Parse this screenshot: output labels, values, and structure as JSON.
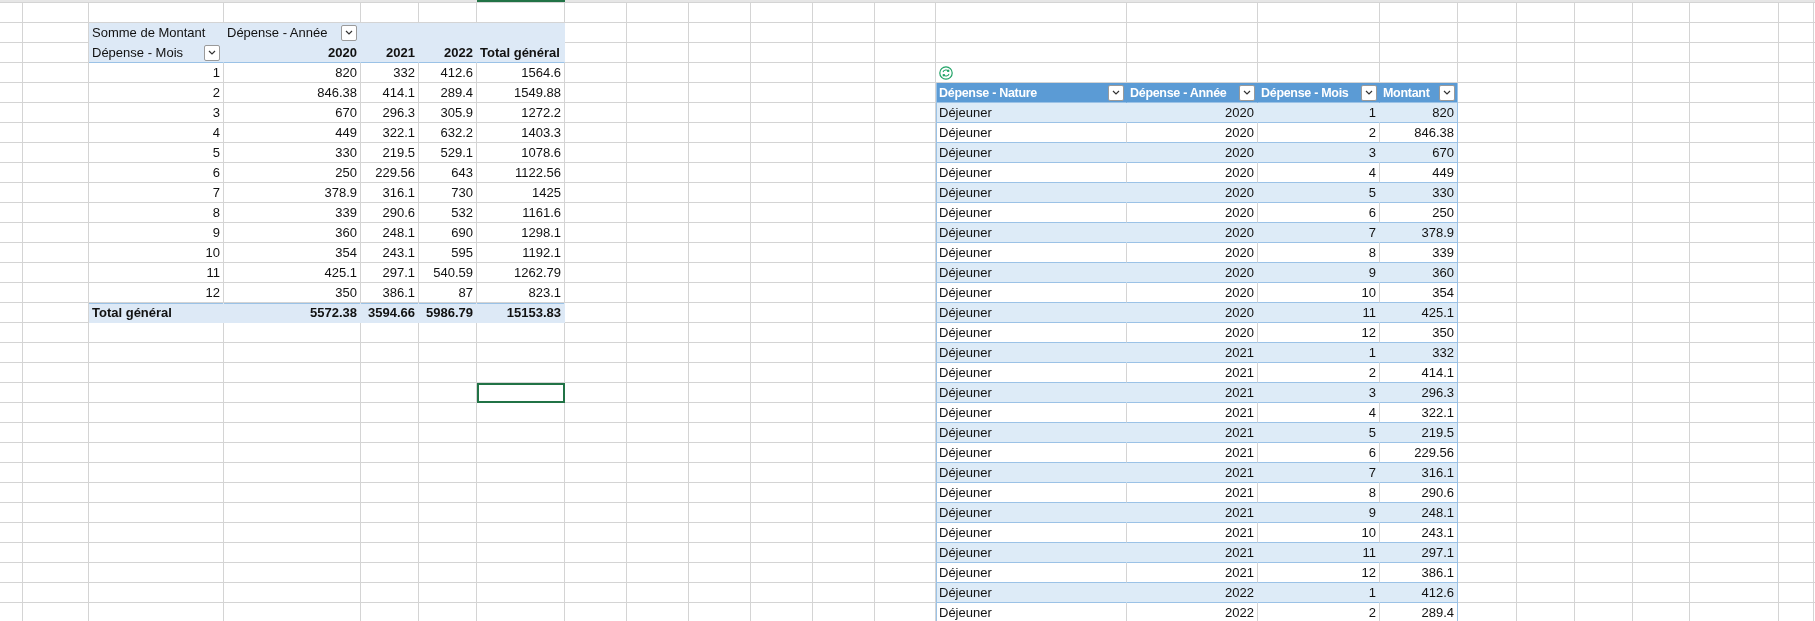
{
  "pivot_table": {
    "value_label": "Somme de Montant",
    "column_field": "Dépense - Année",
    "row_field": "Dépense - Mois",
    "columns": [
      "2020",
      "2021",
      "2022",
      "Total général"
    ],
    "rows": [
      {
        "label": "1",
        "values": [
          "820",
          "332",
          "412.6",
          "1564.6"
        ]
      },
      {
        "label": "2",
        "values": [
          "846.38",
          "414.1",
          "289.4",
          "1549.88"
        ]
      },
      {
        "label": "3",
        "values": [
          "670",
          "296.3",
          "305.9",
          "1272.2"
        ]
      },
      {
        "label": "4",
        "values": [
          "449",
          "322.1",
          "632.2",
          "1403.3"
        ]
      },
      {
        "label": "5",
        "values": [
          "330",
          "219.5",
          "529.1",
          "1078.6"
        ]
      },
      {
        "label": "6",
        "values": [
          "250",
          "229.56",
          "643",
          "1122.56"
        ]
      },
      {
        "label": "7",
        "values": [
          "378.9",
          "316.1",
          "730",
          "1425"
        ]
      },
      {
        "label": "8",
        "values": [
          "339",
          "290.6",
          "532",
          "1161.6"
        ]
      },
      {
        "label": "9",
        "values": [
          "360",
          "248.1",
          "690",
          "1298.1"
        ]
      },
      {
        "label": "10",
        "values": [
          "354",
          "243.1",
          "595",
          "1192.1"
        ]
      },
      {
        "label": "11",
        "values": [
          "425.1",
          "297.1",
          "540.59",
          "1262.79"
        ]
      },
      {
        "label": "12",
        "values": [
          "350",
          "386.1",
          "87",
          "823.1"
        ]
      }
    ],
    "total_row": {
      "label": "Total général",
      "values": [
        "5572.38",
        "3594.66",
        "5986.79",
        "15153.83"
      ]
    }
  },
  "data_table": {
    "columns": [
      "Dépense - Nature",
      "Dépense - Année",
      "Dépense - Mois",
      "Montant"
    ],
    "rows": [
      [
        "Déjeuner",
        "2020",
        "1",
        "820"
      ],
      [
        "Déjeuner",
        "2020",
        "2",
        "846.38"
      ],
      [
        "Déjeuner",
        "2020",
        "3",
        "670"
      ],
      [
        "Déjeuner",
        "2020",
        "4",
        "449"
      ],
      [
        "Déjeuner",
        "2020",
        "5",
        "330"
      ],
      [
        "Déjeuner",
        "2020",
        "6",
        "250"
      ],
      [
        "Déjeuner",
        "2020",
        "7",
        "378.9"
      ],
      [
        "Déjeuner",
        "2020",
        "8",
        "339"
      ],
      [
        "Déjeuner",
        "2020",
        "9",
        "360"
      ],
      [
        "Déjeuner",
        "2020",
        "10",
        "354"
      ],
      [
        "Déjeuner",
        "2020",
        "11",
        "425.1"
      ],
      [
        "Déjeuner",
        "2020",
        "12",
        "350"
      ],
      [
        "Déjeuner",
        "2021",
        "1",
        "332"
      ],
      [
        "Déjeuner",
        "2021",
        "2",
        "414.1"
      ],
      [
        "Déjeuner",
        "2021",
        "3",
        "296.3"
      ],
      [
        "Déjeuner",
        "2021",
        "4",
        "322.1"
      ],
      [
        "Déjeuner",
        "2021",
        "5",
        "219.5"
      ],
      [
        "Déjeuner",
        "2021",
        "6",
        "229.56"
      ],
      [
        "Déjeuner",
        "2021",
        "7",
        "316.1"
      ],
      [
        "Déjeuner",
        "2021",
        "8",
        "290.6"
      ],
      [
        "Déjeuner",
        "2021",
        "9",
        "248.1"
      ],
      [
        "Déjeuner",
        "2021",
        "10",
        "243.1"
      ],
      [
        "Déjeuner",
        "2021",
        "11",
        "297.1"
      ],
      [
        "Déjeuner",
        "2021",
        "12",
        "386.1"
      ],
      [
        "Déjeuner",
        "2022",
        "1",
        "412.6"
      ],
      [
        "Déjeuner",
        "2022",
        "2",
        "289.4"
      ]
    ]
  }
}
